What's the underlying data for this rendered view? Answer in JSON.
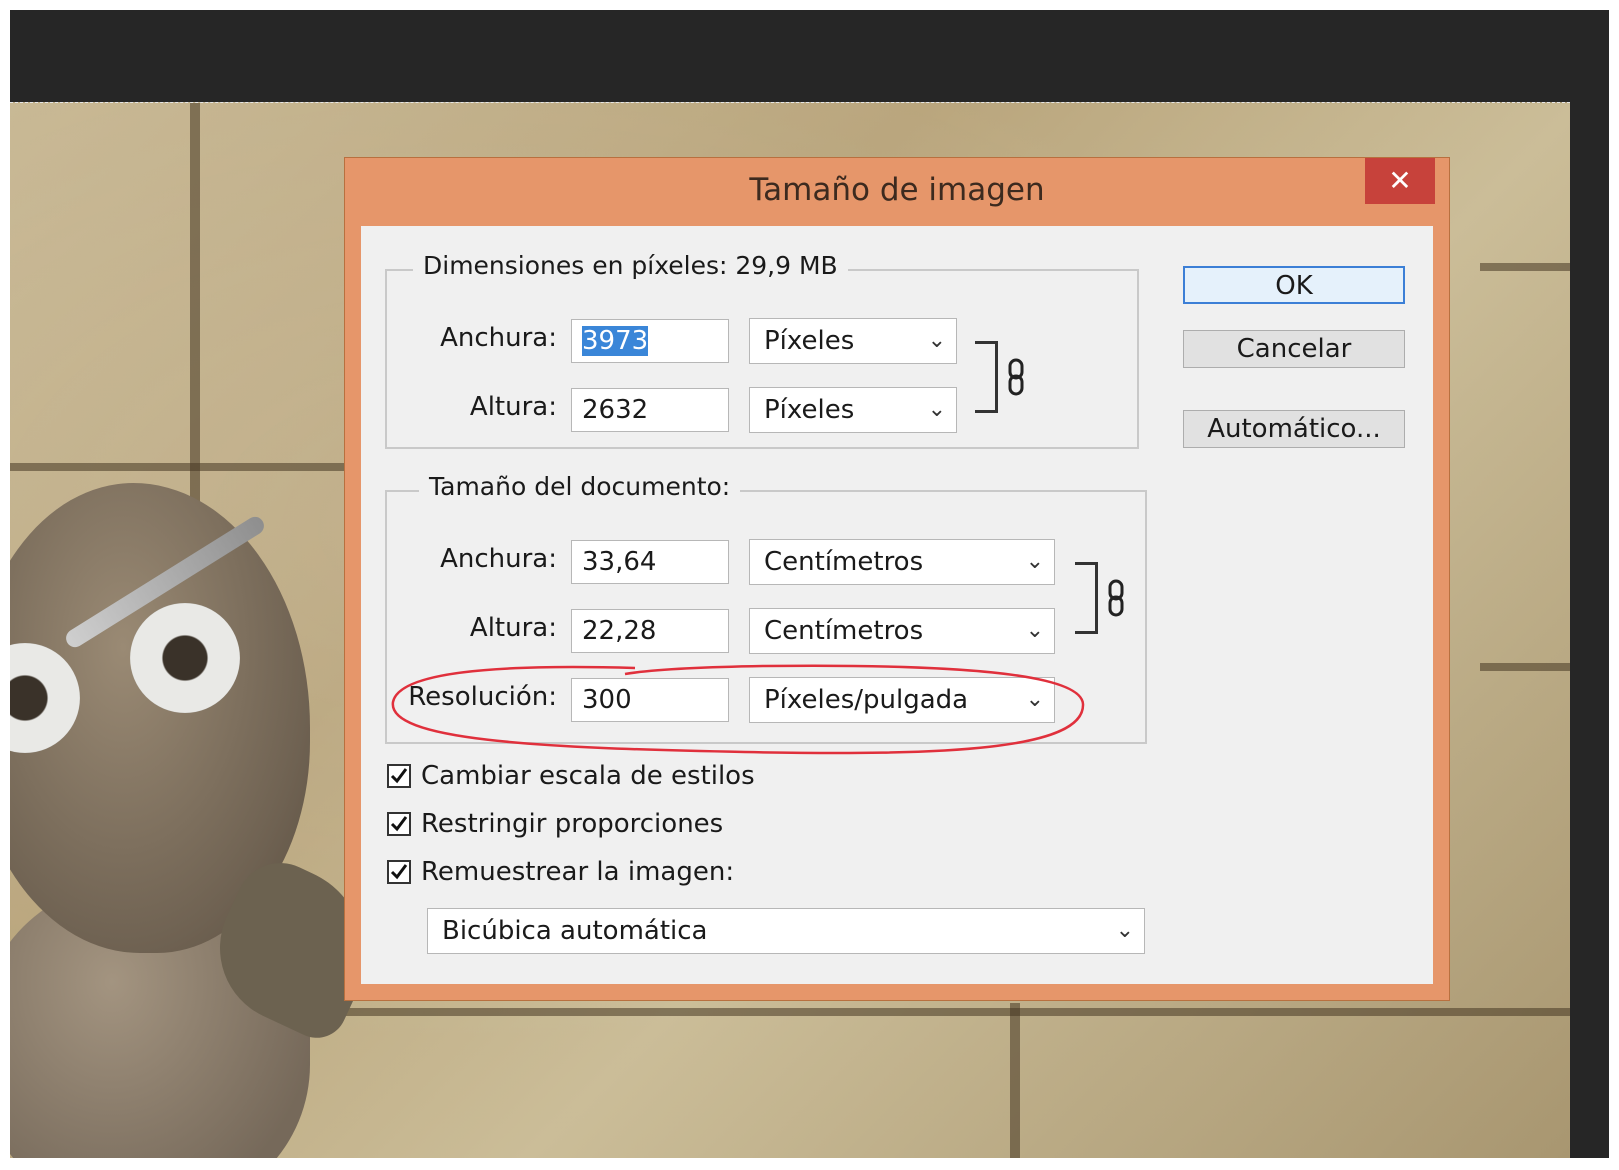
{
  "dialog": {
    "title": "Tamaño de imagen",
    "close_label": "✕"
  },
  "pixel_dimensions": {
    "legend": "Dimensiones en píxeles: 29,9 MB",
    "width_label": "Anchura:",
    "width_value": "3973",
    "width_unit": "Píxeles",
    "height_label": "Altura:",
    "height_value": "2632",
    "height_unit": "Píxeles"
  },
  "document_size": {
    "legend": "Tamaño del documento:",
    "width_label": "Anchura:",
    "width_value": "33,64",
    "width_unit": "Centímetros",
    "height_label": "Altura:",
    "height_value": "22,28",
    "height_unit": "Centímetros",
    "resolution_label": "Resolución:",
    "resolution_value": "300",
    "resolution_unit": "Píxeles/pulgada"
  },
  "buttons": {
    "ok": "OK",
    "cancel": "Cancelar",
    "auto": "Automático..."
  },
  "options": {
    "scale_styles": {
      "label": "Cambiar escala de estilos",
      "checked": true
    },
    "constrain": {
      "label": "Restringir proporciones",
      "checked": true
    },
    "resample": {
      "label": "Remuestrear la imagen:",
      "checked": true
    }
  },
  "resample_method": "Bicúbica automática",
  "colors": {
    "title_bar": "#e6966a",
    "close_button": "#c7423b",
    "selection": "#3a86d8",
    "annotation": "#e0303c"
  }
}
